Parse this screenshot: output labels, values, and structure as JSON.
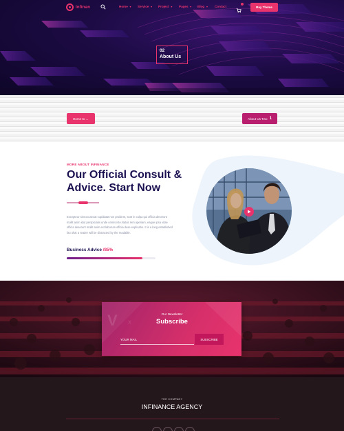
{
  "brand": {
    "name": "Infinan",
    "accent": "#e8336d",
    "navy": "#1c1150"
  },
  "nav": {
    "items": [
      {
        "label": "Home",
        "has_caret": true
      },
      {
        "label": "Service",
        "has_caret": true
      },
      {
        "label": "Project",
        "has_caret": true
      },
      {
        "label": "Pages",
        "has_caret": true
      },
      {
        "label": "Blog",
        "has_caret": true
      },
      {
        "label": "Contact",
        "has_caret": false
      }
    ],
    "buy_label": "Buy Theme",
    "icons": [
      "search-icon",
      "cart-icon"
    ]
  },
  "hero": {
    "number": "02",
    "title": "About Us"
  },
  "pager": {
    "prev_label": "Home to ←",
    "next_label": "About Us Two",
    "next_icon": "1"
  },
  "about": {
    "tag": "MORE ABOUT INFINANCE",
    "heading": "Our Official Consult & Advice. Start Now",
    "body": "Excepteur sint occaecat cupidatat non proident, sunt in culpa qui officia deserunt mollit anim idut perspiciatis unde omnis iste.Natus rem aperiam, eaque ipsa vitae officia deserunt mollit anim est laborum officia dese explicabo. It is a long established fact that a reader will be distracted by the readable.",
    "skill": {
      "label": "Business Advice",
      "sep": " /",
      "percent_text": "85%",
      "value": 0.85
    }
  },
  "newsletter": {
    "small": "Our Newsletter",
    "title": "Subscribe",
    "input_placeholder": "YOUR MAIL",
    "button": "SUBSCRIBE"
  },
  "footer": {
    "small": "THE COMPANY",
    "title": "INFINANCE AGENCY",
    "social_icons": [
      "facebook-icon",
      "twitter-icon",
      "instagram-icon",
      "linkedin-icon"
    ]
  }
}
